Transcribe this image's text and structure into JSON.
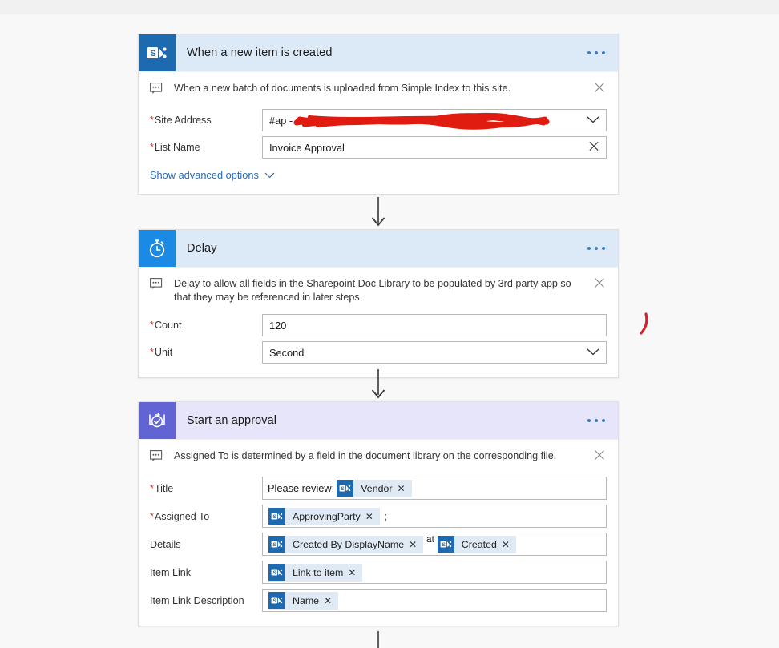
{
  "app": {
    "name": "Microsoft Power Automate flow designer",
    "background_color": "#f7f7f8"
  },
  "cards": [
    {
      "id": "trigger",
      "title": "When a new item is created",
      "icon": "sharepoint-icon",
      "icon_bg": "#1d6ab0",
      "header_bg": "#dce9f7",
      "menu": "ellipsis-menu",
      "note": "When a new batch of documents is uploaded from Simple Index to this site.",
      "fields": [
        {
          "label": "Site Address",
          "required": true,
          "control": "dropdown",
          "value": "#ap -",
          "redacted": true,
          "trailing_icon": "chevron-down-icon"
        },
        {
          "label": "List Name",
          "required": true,
          "control": "combobox",
          "value": "Invoice Approval",
          "redacted": false,
          "trailing_icon": "close-icon"
        }
      ],
      "advanced_link": "Show advanced options"
    },
    {
      "id": "delay",
      "title": "Delay",
      "icon": "stopwatch-icon",
      "icon_bg": "#1a8ae5",
      "header_bg": "#dce9f7",
      "menu": "ellipsis-menu",
      "note": "Delay to allow all fields in the Sharepoint Doc Library to be populated by 3rd party app so that they may be referenced in later steps.",
      "fields": [
        {
          "label": "Count",
          "required": true,
          "control": "text",
          "value": "120",
          "trailing_icon": ""
        },
        {
          "label": "Unit",
          "required": true,
          "control": "dropdown",
          "value": "Second",
          "trailing_icon": "chevron-down-icon"
        }
      ],
      "advanced_link": ""
    },
    {
      "id": "approval",
      "title": "Start an approval",
      "icon": "approval-icon",
      "icon_bg": "#6264d4",
      "header_bg": "#e7e5f9",
      "menu": "ellipsis-menu",
      "note": "Assigned To is determined by a field in the document library on the corresponding file.",
      "fields": [
        {
          "label": "Title",
          "required": true,
          "control": "token-field",
          "prefix_text": "Please review:",
          "tokens": [
            {
              "icon": "sharepoint-icon",
              "label": "Vendor"
            }
          ],
          "suffix_text": ""
        },
        {
          "label": "Assigned To",
          "required": true,
          "control": "token-field",
          "prefix_text": "",
          "tokens": [
            {
              "icon": "sharepoint-icon",
              "label": "ApprovingParty"
            }
          ],
          "suffix_text": ";"
        },
        {
          "label": "Details",
          "required": false,
          "control": "token-field",
          "prefix_text": "",
          "tokens": [
            {
              "icon": "sharepoint-icon",
              "label": "Created By DisplayName"
            },
            {
              "icon": "sharepoint-icon",
              "label": "Created"
            }
          ],
          "between_text": "at",
          "suffix_text": ""
        },
        {
          "label": "Item Link",
          "required": false,
          "control": "token-field",
          "prefix_text": "",
          "tokens": [
            {
              "icon": "sharepoint-icon",
              "label": "Link to item"
            }
          ],
          "suffix_text": ""
        },
        {
          "label": "Item Link Description",
          "required": false,
          "control": "token-field",
          "prefix_text": "",
          "tokens": [
            {
              "icon": "sharepoint-icon",
              "label": "Name"
            }
          ],
          "suffix_text": ""
        }
      ],
      "advanced_link": ""
    }
  ],
  "annotations": {
    "redaction_color": "#e01b10",
    "pen_mark": "red-pen-stroke"
  }
}
